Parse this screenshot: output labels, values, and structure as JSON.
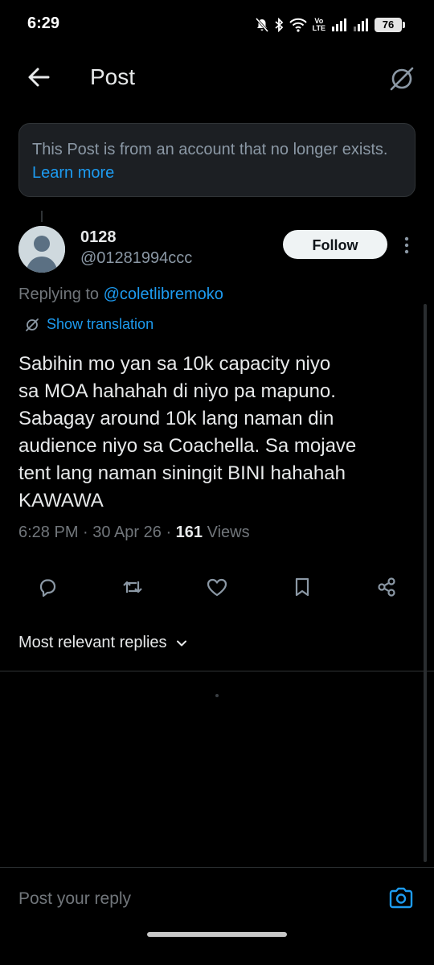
{
  "status_bar": {
    "time": "6:29",
    "lte_top": "Vo",
    "lte_bottom": "LTE",
    "battery": "76"
  },
  "header": {
    "title": "Post",
    "back_icon": "arrow-left-icon",
    "globe_icon": "globe-slash-icon"
  },
  "notice": {
    "text": "This Post is from an account that no longer exists.",
    "link": "Learn more"
  },
  "post": {
    "author_name": "0128",
    "author_handle": "@01281994ccc",
    "follow_label": "Follow",
    "replying_prefix": "Replying to",
    "replying_to": "@coletlibremoko",
    "translate_label": "Show translation",
    "body": "Sabihin mo yan sa 10k capacity niyo\nsa MOA hahahah di niyo pa mapuno.\nSabagay around 10k lang naman din\naudience niyo sa Coachella. Sa mojave\ntent lang naman siningit BINI hahahah\nKAWAWA",
    "time": "6:28 PM",
    "date": "30 Apr 26",
    "views_count": "161",
    "views_label": "Views"
  },
  "actions": [
    "reply-icon",
    "repost-icon",
    "like-icon",
    "bookmark-icon",
    "share-icon"
  ],
  "replies": {
    "sort_label": "Most relevant replies"
  },
  "composer": {
    "placeholder": "Post your reply"
  },
  "colors": {
    "accent": "#1d9bf0",
    "background": "#000000",
    "muted": "#71767b"
  }
}
